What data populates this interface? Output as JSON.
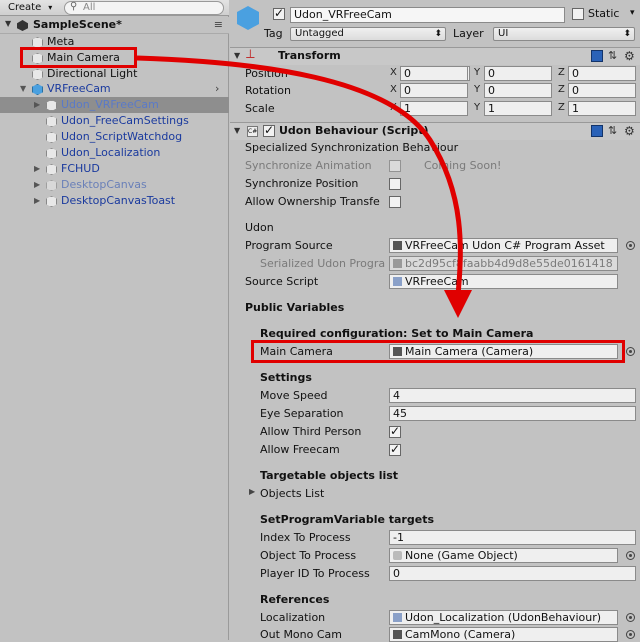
{
  "hierarchy": {
    "create_label": "Create",
    "search_placeholder": "All",
    "scene_name": "SampleScene*",
    "items": [
      {
        "label": "Meta"
      },
      {
        "label": "Main Camera"
      },
      {
        "label": "Directional Light"
      },
      {
        "label": "VRFreeCam"
      },
      {
        "label": "Udon_VRFreeCam"
      },
      {
        "label": "Udon_FreeCamSettings"
      },
      {
        "label": "Udon_ScriptWatchdog"
      },
      {
        "label": "Udon_Localization"
      },
      {
        "label": "FCHUD"
      },
      {
        "label": "DesktopCanvas"
      },
      {
        "label": "DesktopCanvasToast"
      }
    ]
  },
  "inspector": {
    "object_name": "Udon_VRFreeCam",
    "static_label": "Static",
    "tag_label": "Tag",
    "tag_value": "Untagged",
    "layer_label": "Layer",
    "layer_value": "UI",
    "transform": {
      "title": "Transform",
      "position_label": "Position",
      "rotation_label": "Rotation",
      "scale_label": "Scale",
      "axis_x": "X",
      "axis_y": "Y",
      "axis_z": "Z",
      "position": [
        "0",
        "0",
        "0"
      ],
      "rotation": [
        "0",
        "0",
        "0"
      ],
      "scale": [
        "1",
        "1",
        "1"
      ]
    },
    "udon": {
      "title": "Udon Behaviour (Script)",
      "specialized_sync": "Specialized Synchronization Behaviour",
      "sync_animation": "Synchronize Animation",
      "coming_soon": "Coming Soon!",
      "sync_position": "Synchronize Position",
      "allow_ownership": "Allow Ownership Transfe",
      "udon_heading": "Udon",
      "program_source_label": "Program Source",
      "program_source_value": "VRFreeCam Udon C# Program Asset",
      "serialized_label": "Serialized Udon Progra",
      "serialized_value": "bc2d95cf8faabb4d9d8e55de0161418",
      "source_script_label": "Source Script",
      "source_script_value": "VRFreeCam",
      "public_variables": "Public Variables",
      "required_config": "Required configuration: Set to Main Camera",
      "main_camera_label": "Main Camera",
      "main_camera_value": "Main Camera (Camera)",
      "settings_heading": "Settings",
      "move_speed_label": "Move Speed",
      "move_speed_value": "4",
      "eye_sep_label": "Eye Separation",
      "eye_sep_value": "45",
      "allow_third_label": "Allow Third Person",
      "allow_freecam_label": "Allow Freecam",
      "targetable_heading": "Targetable objects list",
      "objects_list_label": "Objects List",
      "setprog_heading": "SetProgramVariable targets",
      "index_label": "Index To Process",
      "index_value": "-1",
      "object_label": "Object To Process",
      "object_value": "None (Game Object)",
      "player_label": "Player ID To Process",
      "player_value": "0",
      "references_heading": "References",
      "localization_label": "Localization",
      "localization_value": "Udon_Localization (UdonBehaviour)",
      "out_mono_label": "Out Mono Cam",
      "out_mono_value": "CamMono (Camera)"
    }
  },
  "colors": {
    "highlight": "#e00000",
    "selection": "#8e8e8e",
    "prefab_text": "#1a3a9e",
    "panel_bg": "#c2c2c2"
  }
}
